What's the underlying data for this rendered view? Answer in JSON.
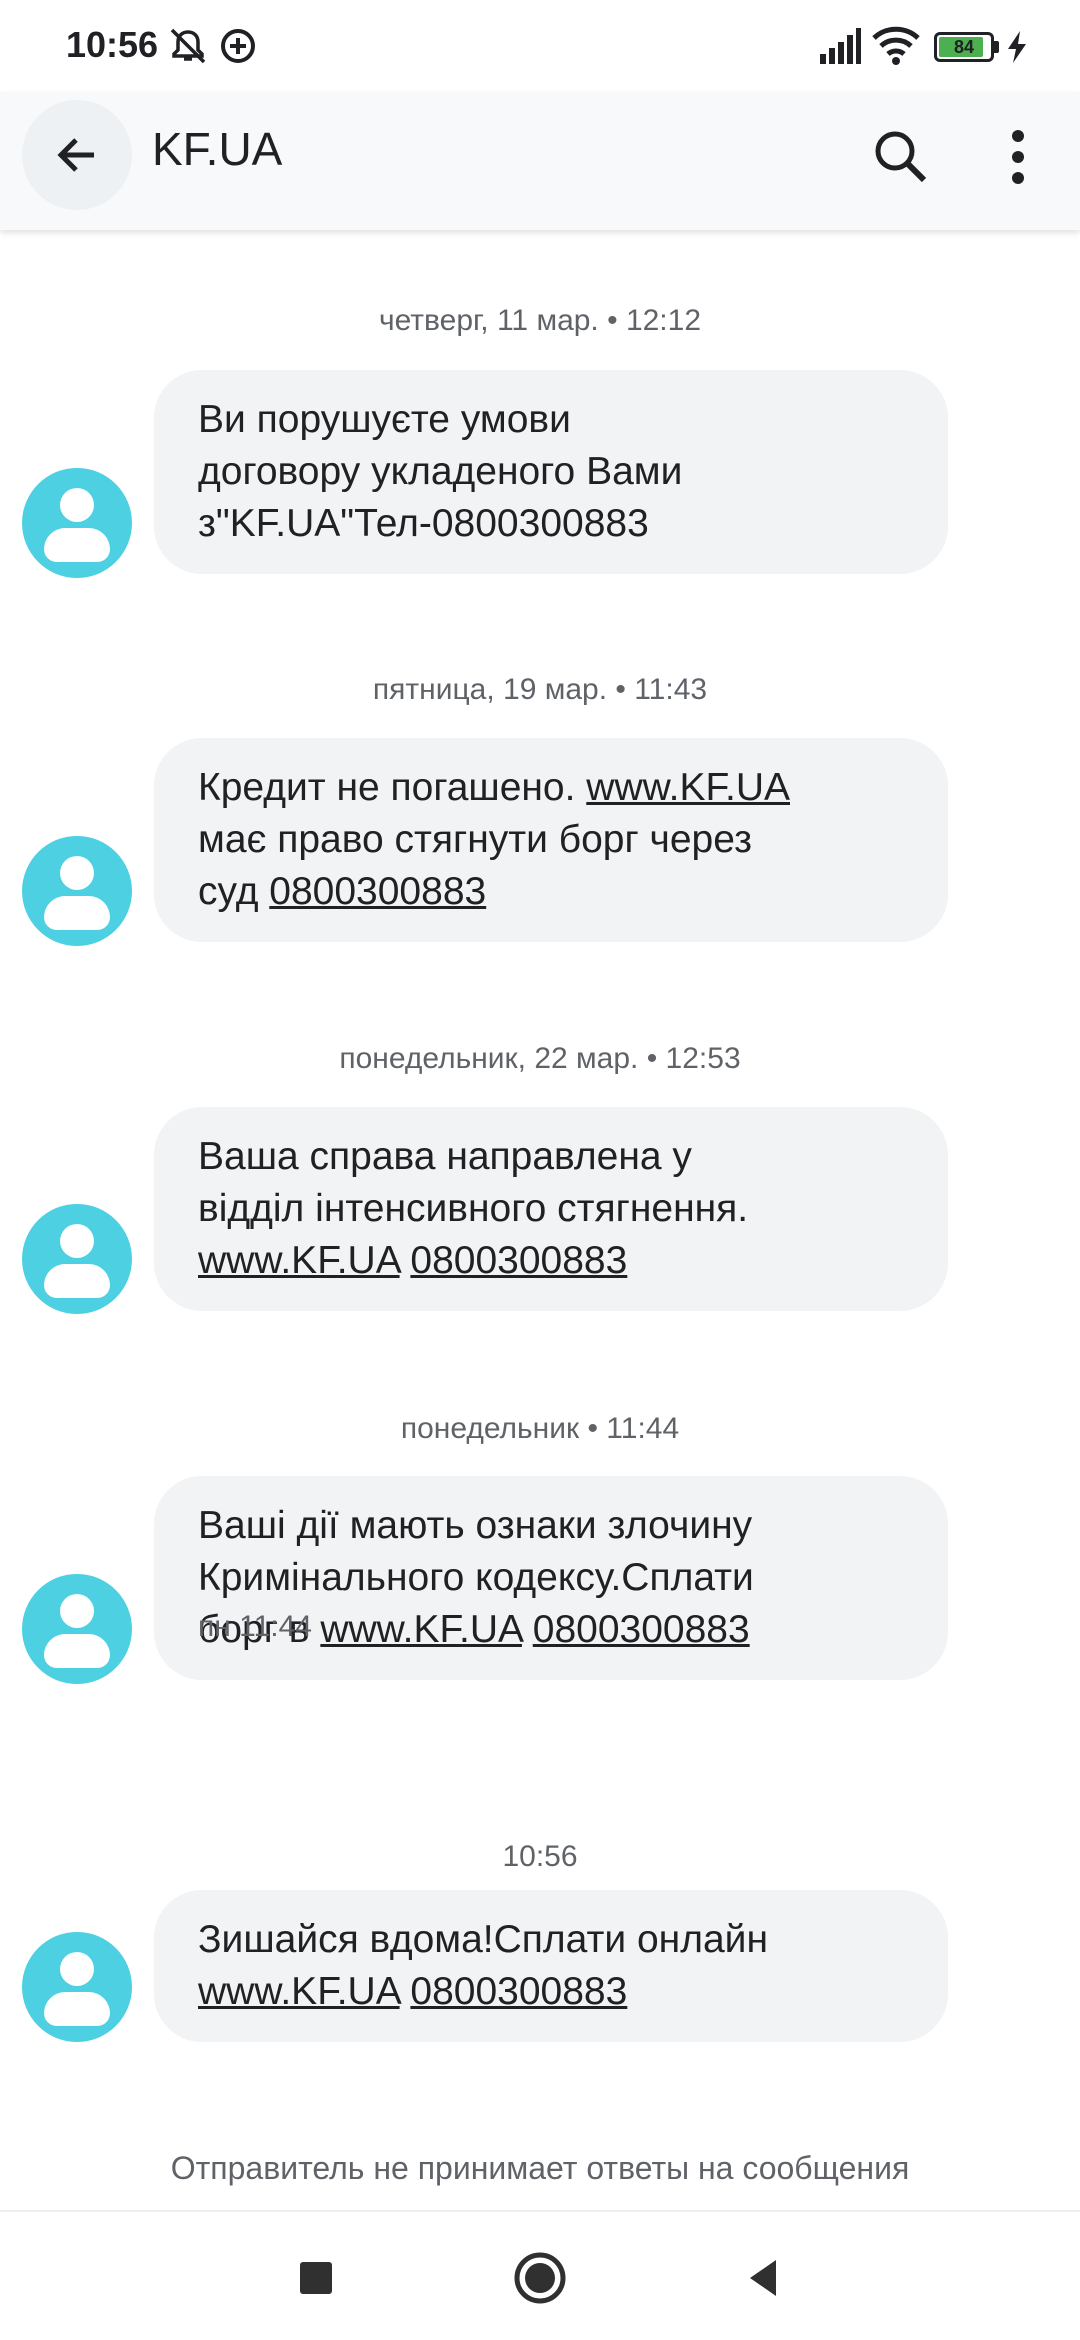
{
  "status_bar": {
    "time": "10:56",
    "battery_level": "84",
    "battery_fraction": 0.84,
    "icons": [
      "mute-icon",
      "data-saver-icon",
      "signal-icon",
      "wifi-icon",
      "battery-icon",
      "charging-icon"
    ]
  },
  "app_bar": {
    "title": "KF.UA",
    "back_icon": "arrow-back-icon",
    "search_icon": "search-icon",
    "more_icon": "more-vert-icon"
  },
  "messages": [
    {
      "date": "четверг, 11 мар. • 12:12",
      "lines": [
        [
          {
            "t": "Ви порушуєте умови"
          }
        ],
        [
          {
            "t": "договору укладеного Вами"
          }
        ],
        [
          {
            "t": "з\"KF.UA\"Тел-0800300883"
          }
        ]
      ]
    },
    {
      "date": "пятница, 19 мар. • 11:43",
      "lines": [
        [
          {
            "t": "Кредит не погашено. "
          },
          {
            "t": "www.KF.UA",
            "link": true
          }
        ],
        [
          {
            "t": "має право стягнути борг через"
          }
        ],
        [
          {
            "t": "суд "
          },
          {
            "t": "0800300883",
            "link": true
          }
        ]
      ]
    },
    {
      "date": "понедельник, 22 мар. • 12:53",
      "lines": [
        [
          {
            "t": "Ваша справа направлена у"
          }
        ],
        [
          {
            "t": "відділ інтенсивного стягнення."
          }
        ],
        [
          {
            "t": "www.KF.UA",
            "link": true
          },
          {
            "t": " "
          },
          {
            "t": "0800300883",
            "link": true
          }
        ]
      ]
    },
    {
      "date": "понедельник • 11:44",
      "lines": [
        [
          {
            "t": "Ваші дії мають ознаки злочину"
          }
        ],
        [
          {
            "t": "Кримінального кодексу.Сплати"
          }
        ],
        [
          {
            "t": "борг в "
          },
          {
            "t": "www.KF.UA",
            "link": true
          },
          {
            "t": " "
          },
          {
            "t": "0800300883",
            "link": true
          }
        ]
      ],
      "time": "пн 11:44"
    },
    {
      "date": "10:56",
      "lines": [
        [
          {
            "t": "Зишайся вдома!Сплати онлайн"
          }
        ],
        [
          {
            "t": "www.KF.UA",
            "link": true
          },
          {
            "t": " "
          },
          {
            "t": "0800300883",
            "link": true
          }
        ]
      ]
    }
  ],
  "footer_note": "Отправитель не принимает ответы на сообщения",
  "nav_bar": {
    "icons": [
      "recents-square-icon",
      "home-circle-icon",
      "back-triangle-icon"
    ]
  },
  "colors": {
    "avatar": "#4dd0e1",
    "bubble": "#f1f3f4",
    "app_bar": "#f8f9fa",
    "battery": "#4caf50"
  }
}
